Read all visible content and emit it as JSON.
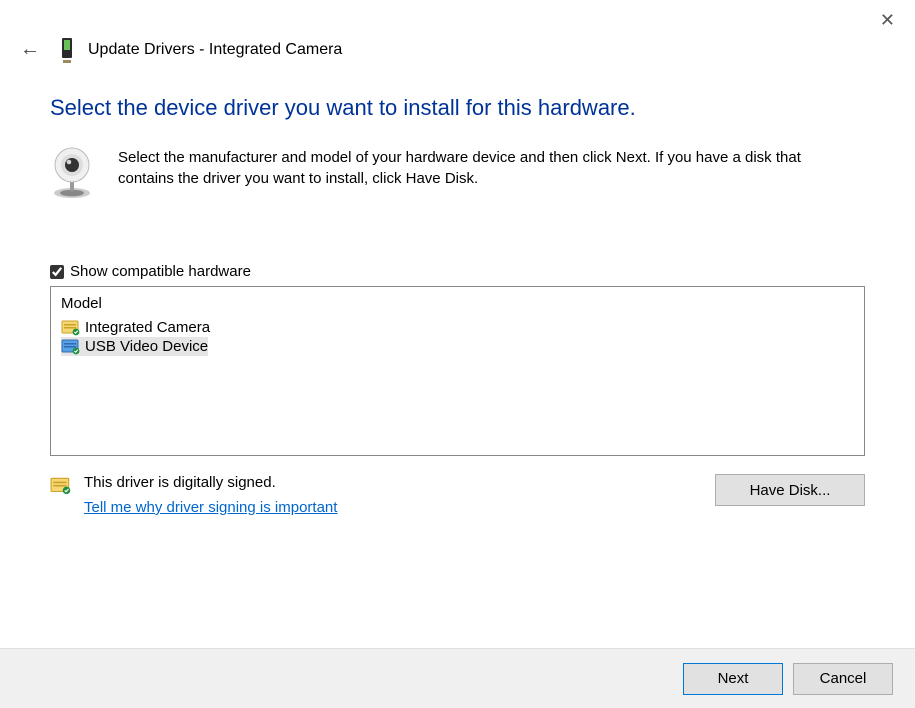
{
  "window": {
    "title": "Update Drivers - Integrated Camera"
  },
  "heading": "Select the device driver you want to install for this hardware.",
  "instruction": "Select the manufacturer and model of your hardware device and then click Next. If you have a disk that contains the driver you want to install, click Have Disk.",
  "checkbox": {
    "label": "Show compatible hardware",
    "checked": true
  },
  "model_list": {
    "header": "Model",
    "items": [
      {
        "label": "Integrated Camera",
        "selected": false,
        "icon": "cert-yellow"
      },
      {
        "label": "USB Video Device",
        "selected": true,
        "icon": "cert-blue"
      }
    ]
  },
  "signed": {
    "message": "This driver is digitally signed.",
    "link": "Tell me why driver signing is important"
  },
  "buttons": {
    "have_disk": "Have Disk...",
    "next": "Next",
    "cancel": "Cancel"
  }
}
